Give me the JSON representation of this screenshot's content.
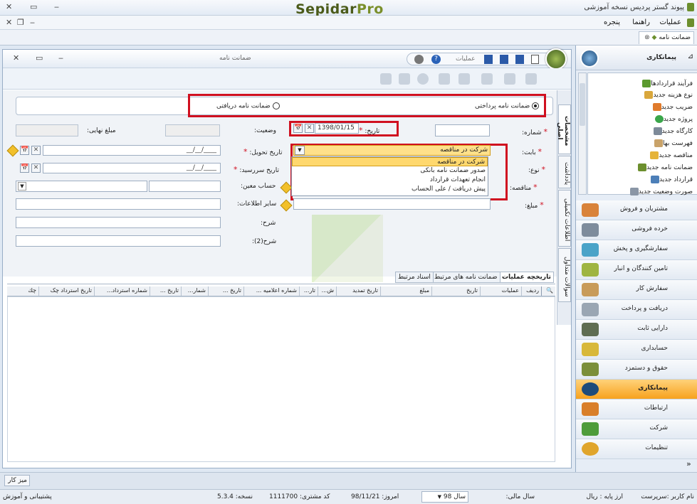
{
  "app": {
    "brand_a": "Sepidar",
    "brand_b": "Pro",
    "window_title": "پیوند گستر پردیس نسخه آموزشی"
  },
  "menu": {
    "items": [
      "عملیات",
      "راهنما",
      "پنجره"
    ]
  },
  "doc_tab": {
    "label": "ضمانت نامه"
  },
  "form_window": {
    "title": "ضمانت نامه",
    "toolbar_ops": "عملیات",
    "radio_paid": "ضمانت نامه پرداختی",
    "radio_received": "ضمانت نامه دریافتی",
    "number_label": "شماره:",
    "date_label": "تاریخ:",
    "date_value": "1398/01/15",
    "status_label": "وضعیت:",
    "final_amount_label": "مبلغ نهایی:",
    "babat_label": "بابت:",
    "babat_value": "شرکت در مناقصه",
    "delivery_date_label": "تاریخ تحویل:",
    "type_label": "نوع:",
    "due_date_label": "تاریخ سررسید:",
    "tender_label": "مناقصه:",
    "account_label": "حساب معین:",
    "amount_label": "مبلغ:",
    "other_info_label": "سایر اطلاعات:",
    "desc_label": "شرح:",
    "desc2_label": "شرح(2):",
    "empty_date": "__/__/____",
    "dropdown_options": [
      "شرکت در مناقصه",
      "صدور ضمانت نامه بانکی",
      "انجام تعهدات قرارداد",
      "پیش دریافت / علی الحساب"
    ],
    "vtabs": [
      "مشخصات اصلی",
      "یادداشت",
      "اطلاعات تکمیلی",
      "سوالات متداول"
    ],
    "subtabs": [
      "تاریخچه عملیات",
      "ضمانت نامه های مرتبط",
      "اسناد مرتبط"
    ],
    "grid_columns": [
      "ردیف",
      "عملیات",
      "تاریخ",
      "مبلغ",
      "تاریخ تمدید",
      "ش...",
      "تار...",
      "شماره اعلامیه ...",
      "تاریخ ...",
      "شمار...",
      "تاریخ ...",
      "شماره استرداد...",
      "تاریخ استرداد چک",
      "چك"
    ]
  },
  "right_panel": {
    "title": "پیمانکاری",
    "items": [
      "فرآیند قراردادها",
      "نوع هزینه جدید",
      "ضریب جدید",
      "پروژه جدید",
      "کارگاه جدید",
      "فهرست بها",
      "مناقصه جدید",
      "ضمانت نامه جدید",
      "قرارداد جدید",
      "صورت وضعیت جدید"
    ],
    "modules": [
      "مشتریان و فروش",
      "خرده فروشی",
      "سفارشگیری و پخش",
      "تامین کنندگان و انبار",
      "سفارش کار",
      "دریافت و پرداخت",
      "دارایی ثابت",
      "حسابداری",
      "حقوق و دستمزد",
      "پیمانکاری",
      "ارتباطات",
      "شرکت",
      "تنظیمات"
    ],
    "active_module": "پیمانکاری"
  },
  "taskbar": {
    "desk": "میز کار"
  },
  "status": {
    "user": "نام کاربر :سرپرست",
    "currency": "ارز پایه : ریال",
    "fiscal_label": "سال مالی:",
    "fiscal_value": "سال 98",
    "today": "امروز:  98/11/21",
    "customer_code": "کد مشتری:  1111700",
    "version": "نسخه:   5.3.4",
    "support": "پشتیبانی و آموزش"
  },
  "colors": {
    "accent_red": "#d01020",
    "highlight": "#ffd86e",
    "active_module": "#f7a21e"
  }
}
